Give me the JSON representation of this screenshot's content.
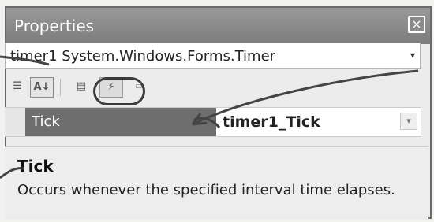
{
  "window": {
    "title": "Properties",
    "close_glyph": "×"
  },
  "object_selector": {
    "value": "timer1 System.Windows.Forms.Timer",
    "arrow_glyph": "▾"
  },
  "toolbar": {
    "items": [
      {
        "name": "categorized-icon",
        "glyph": "☰"
      },
      {
        "name": "alphabetical-icon",
        "glyph": "A↓"
      },
      {
        "name": "properties-icon",
        "glyph": "▤"
      },
      {
        "name": "events-icon",
        "glyph": "⚡"
      },
      {
        "name": "property-pages-icon",
        "glyph": "▭"
      }
    ]
  },
  "grid": {
    "row": {
      "name": "Tick",
      "value": "timer1_Tick",
      "dropdown_glyph": "▾"
    }
  },
  "description": {
    "title": "Tick",
    "text": "Occurs whenever the specified interval time elapses."
  }
}
